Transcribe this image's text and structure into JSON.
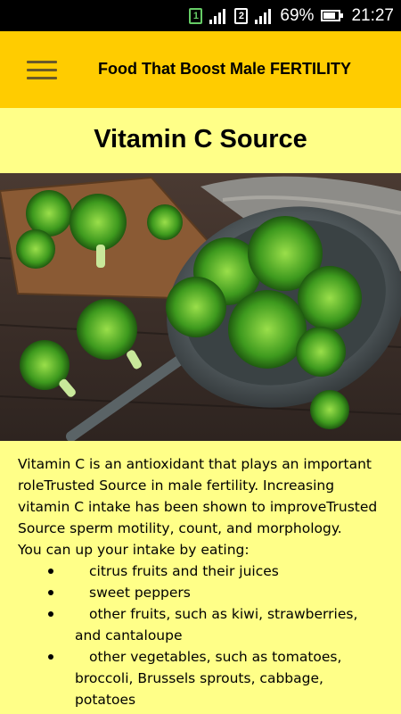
{
  "statusbar": {
    "sim1": "1",
    "sim2": "2",
    "battery": "69%",
    "time": "21:27"
  },
  "appbar": {
    "title": "Food That Boost Male FERTILITY",
    "menu_icon": "hamburger-menu-icon"
  },
  "page": {
    "title": "Vitamin C Source",
    "image": "broccoli-in-strainer-photo"
  },
  "content": {
    "intro": "Vitamin C is an antioxidant that plays an important roleTrusted Source in male fertility. Increasing vitamin C intake has been shown to improveTrusted Source sperm motility, count, and morphology.",
    "list_lead": "You can up your intake by eating:",
    "items": [
      "citrus fruits and their juices",
      "sweet peppers",
      "other fruits, such as kiwi, strawberries, and cantaloupe",
      "other vegetables, such as tomatoes, broccoli, Brussels sprouts, cabbage, potatoes"
    ]
  },
  "colors": {
    "appbar": "#ffcc00",
    "background": "#ffff88",
    "statusbar": "#000000"
  }
}
